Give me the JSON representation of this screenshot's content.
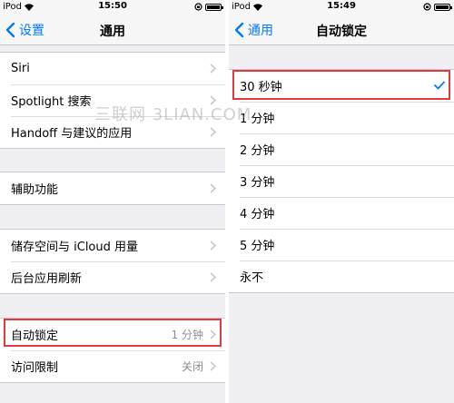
{
  "left": {
    "status": {
      "carrier": "iPod",
      "time": "15:50"
    },
    "nav": {
      "back_label": "设置",
      "title": "通用"
    },
    "group1": [
      {
        "label": "Siri"
      },
      {
        "label": "Spotlight 搜索"
      },
      {
        "label": "Handoff 与建议的应用"
      }
    ],
    "group2": [
      {
        "label": "辅助功能"
      }
    ],
    "group3": [
      {
        "label": "储存空间与 iCloud 用量"
      },
      {
        "label": "后台应用刷新"
      }
    ],
    "group4": [
      {
        "label": "自动锁定",
        "value": "1 分钟"
      },
      {
        "label": "访问限制",
        "value": "关闭"
      }
    ]
  },
  "right": {
    "status": {
      "carrier": "iPod",
      "time": "15:49"
    },
    "nav": {
      "back_label": "通用",
      "title": "自动锁定"
    },
    "options": [
      {
        "label": "30 秒钟",
        "selected": true
      },
      {
        "label": "1 分钟"
      },
      {
        "label": "2 分钟"
      },
      {
        "label": "3 分钟"
      },
      {
        "label": "4 分钟"
      },
      {
        "label": "5 分钟"
      },
      {
        "label": "永不"
      }
    ]
  },
  "watermark": "三联网 3LIAN.COM",
  "colors": {
    "accent": "#007aff",
    "highlight": "#e0393e",
    "background": "#efeff4"
  }
}
